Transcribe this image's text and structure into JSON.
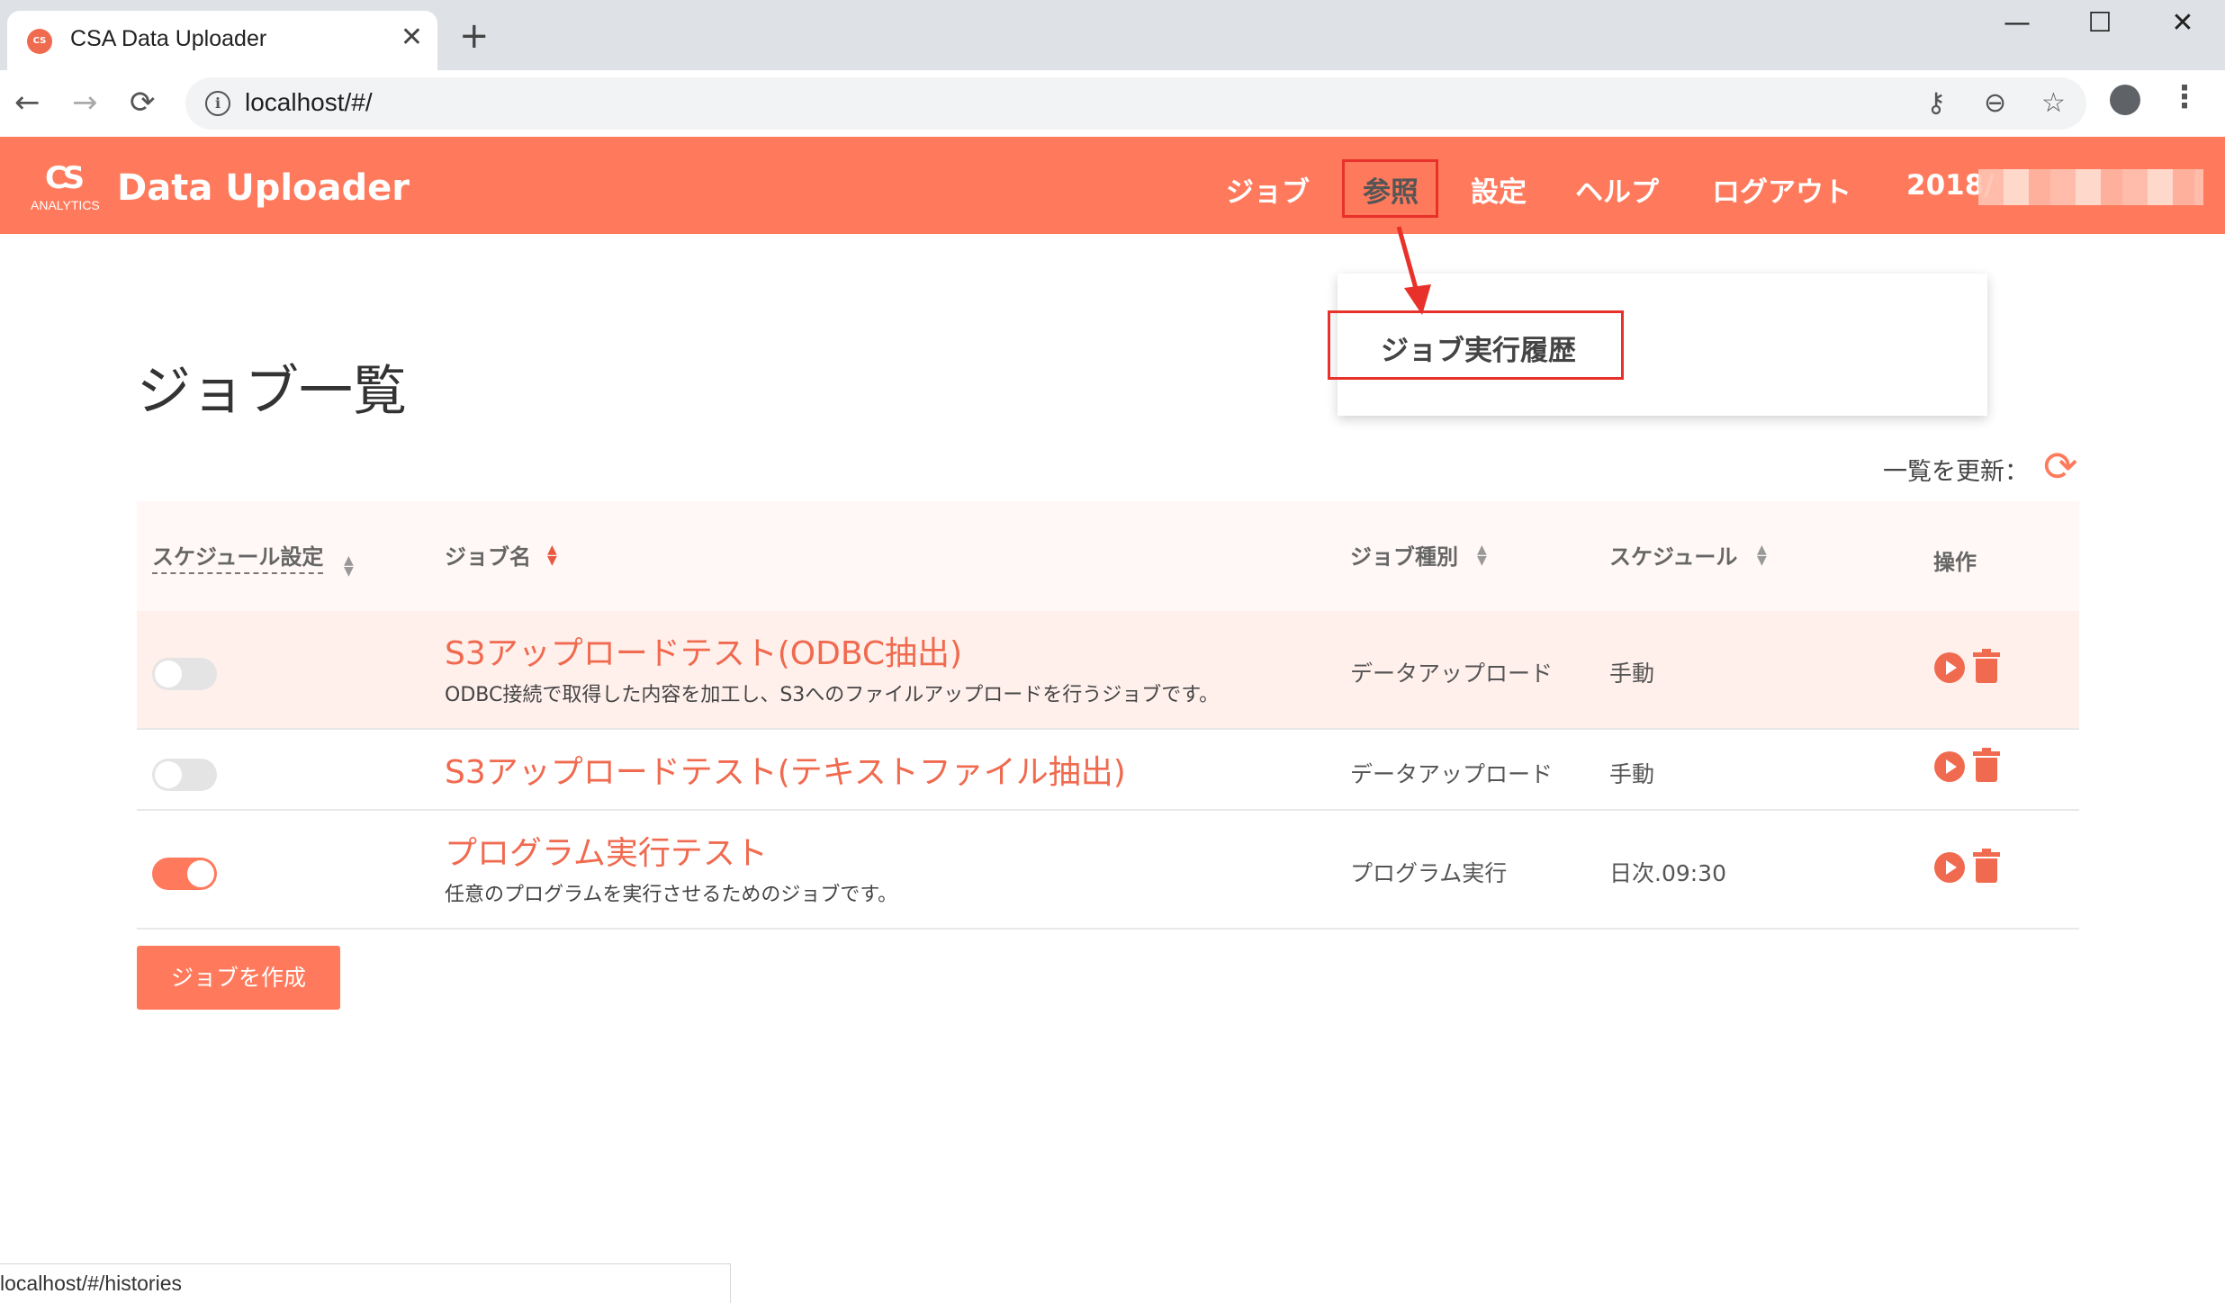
{
  "browser": {
    "tab_title": "CSA Data Uploader",
    "tab_close": "✕",
    "new_tab": "+",
    "window_controls": {
      "minimize": "—",
      "maximize": "☐",
      "close": "✕"
    },
    "url": "localhost/#/",
    "favicon_text": "CS"
  },
  "header": {
    "logo_symbol": "CS",
    "logo_sub": "ANALYTICS",
    "title": "Data Uploader",
    "nav": [
      "ジョブ",
      "参照",
      "設定",
      "ヘルプ",
      "ログアウト"
    ],
    "date_prefix": "2018/",
    "accent_color": "#ff7a5c"
  },
  "dropdown": {
    "item": "ジョブ実行履歴"
  },
  "main": {
    "title": "ジョブ一覧",
    "refresh_label": "一覧を更新：",
    "columns": [
      "スケジュール設定",
      "ジョブ名",
      "ジョブ種別",
      "スケジュール",
      "操作"
    ],
    "jobs": [
      {
        "enabled": false,
        "name": "S3アップロードテスト(ODBC抽出)",
        "description": "ODBC接続で取得した内容を加工し、S3へのファイルアップロードを行うジョブです。",
        "type": "データアップロード",
        "schedule": "手動"
      },
      {
        "enabled": false,
        "name": "S3アップロードテスト(テキストファイル抽出)",
        "description": "",
        "type": "データアップロード",
        "schedule": "手動"
      },
      {
        "enabled": true,
        "name": "プログラム実行テスト",
        "description": "任意のプログラムを実行させるためのジョブです。",
        "type": "プログラム実行",
        "schedule": "日次.09:30"
      }
    ],
    "create_button": "ジョブを作成"
  },
  "status_bar": {
    "url": "localhost/#/histories"
  }
}
